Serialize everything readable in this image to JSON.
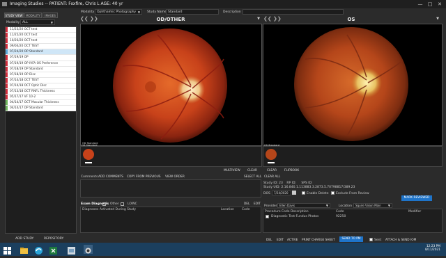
{
  "window": {
    "title": "Imaging Studies -- PATIENT: Foxfire, Chris L   AGE: 40 yr"
  },
  "header": {
    "modality_label": "Modality",
    "modality_value": "Ophthalmic Photography",
    "study_name_label": "Study Name",
    "study_name_value": "Standard",
    "description_label": "Description"
  },
  "left_tabs": [
    "STUDY VIEW",
    "MODALITY",
    "IMAGES"
  ],
  "filter": {
    "label": "Modality",
    "value": "ALL"
  },
  "studies": [
    {
      "label": "11/23/20  OCT test",
      "color": "#d12b3b"
    },
    {
      "label": "11/25/20  OCT test",
      "color": "#d12b3b"
    },
    {
      "label": "10/26/20  OCT test",
      "color": "#d12b3b"
    },
    {
      "label": "09/04/20  OCT TEST",
      "color": "#d12b3b"
    },
    {
      "label": "07/24/20  OP Standard",
      "color": "#5aa7d8",
      "selected": true
    },
    {
      "label": "07/19/19  OP",
      "color": "#d12b3b"
    },
    {
      "label": "07/19/19  OP IVFA OS Preference",
      "color": "#d12b3b"
    },
    {
      "label": "07/18/19  OP Standard",
      "color": "#d12b3b"
    },
    {
      "label": "07/18/19  OP Disc",
      "color": "#d12b3b"
    },
    {
      "label": "07/14/18  OCT TEST",
      "color": "#d12b3b"
    },
    {
      "label": "07/14/18  OCT Optic Disc",
      "color": "#d12b3b"
    },
    {
      "label": "07/13/18  OCT RNFL Thickness",
      "color": "#d12b3b"
    },
    {
      "label": "05/17/17  VF 10-2",
      "color": "#d12b3b"
    },
    {
      "label": "04/14/17  OCT Macular Thickness",
      "color": "#6db35a"
    },
    {
      "label": "04/14/17  OP Standard",
      "color": "#6db35a"
    }
  ],
  "left_bottom": {
    "add_study": "ADD STUDY",
    "repository": "REPOSITORY"
  },
  "viewer": {
    "left_title": "OD/OTHER",
    "right_title": "OS",
    "left_tag": "OD Standard",
    "right_tag": "OS Standard"
  },
  "viewer_toolbar": {
    "multiview": "MULTIVIEW",
    "clear_left": "CLEAR",
    "clear_right": "CLEAR",
    "flipbook": "FLIPBOOK"
  },
  "comments": {
    "label": "Comments",
    "add": "ADD COMMENTS",
    "copy_prev": "COPY FROM PREVIOUS",
    "view_order": "VIEW ORDER",
    "select_all": "SELECT ALL",
    "clear_all": "CLEAR ALL"
  },
  "study_info": {
    "study_id_label": "Study ID:",
    "study_id": "23",
    "rp_id_label": "RP ID:",
    "sps_id_label": "SPS ID:",
    "study_uid_label": "Study UID:",
    "study_uid": "2.16.840.1.113883.3.2873.5.70798817/389.23",
    "dos_label": "DOS",
    "dos_value": "7/24/2020",
    "enable_delete": "Enable Delete",
    "exclude_review": "Exclude From Review",
    "mark_reviewed": "MARK REVIEWED"
  },
  "exam_diagnosis": {
    "title": "Exam Diagnosis",
    "other": "Other",
    "loinc": "LOINC",
    "del": "DEL",
    "edit": "EDIT",
    "activated": "Diagnoses Activated During Study",
    "location": "Location",
    "code": "Code"
  },
  "provider": {
    "label": "Provider",
    "value": "Ellen Davis",
    "location_label": "Location",
    "location_value": "Squire Vision Main",
    "col_desc": "Procedure Code Description",
    "col_code": "Code",
    "col_modifier": "Modifier",
    "row_desc": "Diagnostic Test-Fundus Photos",
    "row_code": "92250"
  },
  "bottom_actions": {
    "del": "DEL",
    "edit": "EDIT",
    "active": "ACTIVE",
    "print": "PRINT CHARGE SHEET",
    "send_pm": "SEND TO PM",
    "sent": "Sent",
    "attach": "ATTACH & SEND IOM"
  },
  "taskbar": {
    "time": "12:23 PM",
    "date": "8/11/2021"
  },
  "colors": {
    "accent": "#1f74c9",
    "taskbar": "#1b3f5e"
  }
}
